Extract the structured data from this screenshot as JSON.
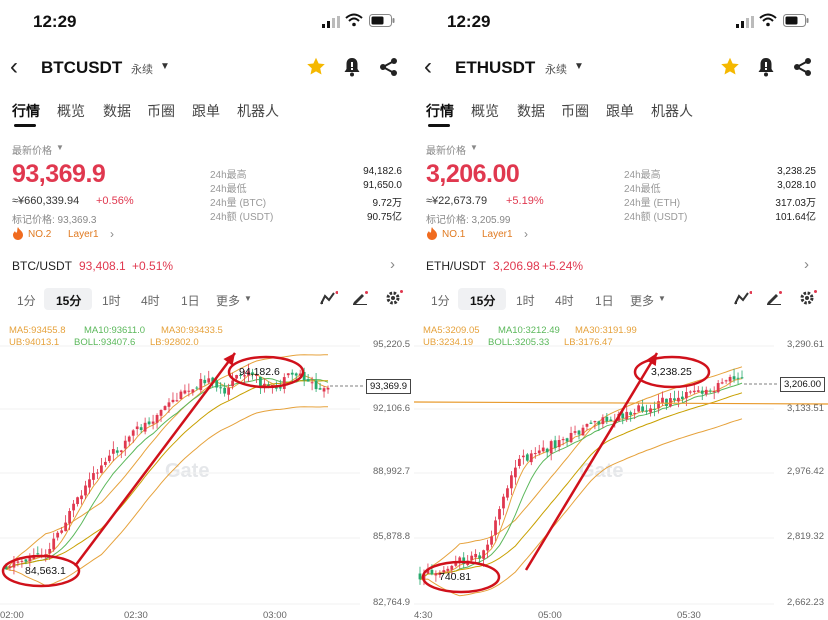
{
  "panels": [
    {
      "status_time": "12:29",
      "symbol": "BTCUSDT",
      "contract": "永续",
      "tabs": [
        "行情",
        "概览",
        "数据",
        "币圈",
        "跟单",
        "机器人"
      ],
      "latest_price_label": "最新价格",
      "price": "93,369.9",
      "price_cny": "≈¥660,339.94",
      "change": "+0.56%",
      "mark_price": "标记价格: 93,369.3",
      "stats": [
        {
          "label": "24h最高",
          "value": "94,182.6"
        },
        {
          "label": "24h最低",
          "value": "91,650.0"
        },
        {
          "label": "24h量 (BTC)",
          "value": "9.72万"
        },
        {
          "label": "24h额 (USDT)",
          "value": "90.75亿"
        }
      ],
      "rank": "NO.2",
      "sector": "Layer1",
      "spot_pair": "BTC/USDT",
      "spot_price": "93,408.1",
      "spot_change": "+0.51%",
      "intervals": [
        "1分",
        "15分",
        "1时",
        "4时",
        "1日",
        "更多"
      ],
      "ma_line1": {
        "ma5": "MA5:93455.8",
        "ma10": "MA10:93611.0",
        "ma30": "MA30:93433.5"
      },
      "ma_line2": {
        "ub": "UB:94013.1",
        "boll": "BOLL:93407.6",
        "lb": "LB:92802.0"
      },
      "axis_labels": [
        "95,220.5",
        "92,106.6",
        "88,992.7",
        "85,878.8",
        "82,764.9"
      ],
      "current_price_tag": "93,369.9",
      "time_labels": [
        "02:00",
        "02:30",
        "03:00"
      ],
      "annotation_high": "94,182.6",
      "annotation_low": "84,563.1",
      "watermark": "Gate"
    },
    {
      "status_time": "12:29",
      "symbol": "ETHUSDT",
      "contract": "永续",
      "tabs": [
        "行情",
        "概览",
        "数据",
        "币圈",
        "跟单",
        "机器人"
      ],
      "latest_price_label": "最新价格",
      "price": "3,206.00",
      "price_cny": "≈¥22,673.79",
      "change": "+5.19%",
      "mark_price": "标记价格: 3,205.99",
      "stats": [
        {
          "label": "24h最高",
          "value": "3,238.25"
        },
        {
          "label": "24h最低",
          "value": "3,028.10"
        },
        {
          "label": "24h量 (ETH)",
          "value": "317.03万"
        },
        {
          "label": "24h额 (USDT)",
          "value": "101.64亿"
        }
      ],
      "rank": "NO.1",
      "sector": "Layer1",
      "spot_pair": "ETH/USDT",
      "spot_price": "3,206.98",
      "spot_change": "+5.24%",
      "intervals": [
        "1分",
        "15分",
        "1时",
        "4时",
        "1日",
        "更多"
      ],
      "ma_line1": {
        "ma5": "MA5:3209.05",
        "ma10": "MA10:3212.49",
        "ma30": "MA30:3191.99"
      },
      "ma_line2": {
        "ub": "UB:3234.19",
        "boll": "BOLL:3205.33",
        "lb": "LB:3176.47"
      },
      "axis_labels": [
        "3,290.61",
        "3,206.00",
        "3,133.51",
        "2,976.42",
        "2,819.32",
        "2,662.23"
      ],
      "current_price_tag": "3,206.00",
      "time_labels": [
        "4:30",
        "05:00",
        "05:30"
      ],
      "annotation_high": "3,238.25",
      "annotation_low": "740.81",
      "watermark": "Gate"
    }
  ],
  "colors": {
    "up": "#e0384f",
    "down": "#26a96c",
    "annotation": "#d0111b",
    "accent_star": "#f5b800",
    "tag_orange": "#e07a21"
  }
}
